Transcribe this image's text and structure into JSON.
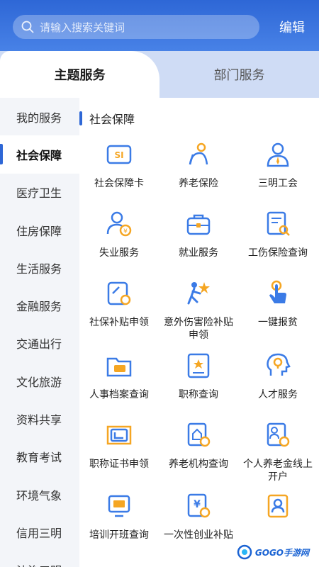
{
  "header": {
    "search_placeholder": "请输入搜索关键词",
    "edit_label": "编辑"
  },
  "tabs": [
    {
      "label": "主题服务",
      "active": true
    },
    {
      "label": "部门服务",
      "active": false
    }
  ],
  "sidebar": {
    "items": [
      {
        "label": "我的服务"
      },
      {
        "label": "社会保障",
        "active": true
      },
      {
        "label": "医疗卫生"
      },
      {
        "label": "住房保障"
      },
      {
        "label": "生活服务"
      },
      {
        "label": "金融服务"
      },
      {
        "label": "交通出行"
      },
      {
        "label": "文化旅游"
      },
      {
        "label": "资料共享"
      },
      {
        "label": "教育考试"
      },
      {
        "label": "环境气象"
      },
      {
        "label": "信用三明"
      },
      {
        "label": "法治三明"
      }
    ]
  },
  "section": {
    "title": "社会保障",
    "services": [
      {
        "label": "社会保障卡",
        "icon": "social-security-card-icon"
      },
      {
        "label": "养老保险",
        "icon": "pension-insurance-icon"
      },
      {
        "label": "三明工会",
        "icon": "trade-union-icon"
      },
      {
        "label": "失业服务",
        "icon": "unemployment-icon"
      },
      {
        "label": "就业服务",
        "icon": "briefcase-icon"
      },
      {
        "label": "工伤保险查询",
        "icon": "injury-insurance-query-icon"
      },
      {
        "label": "社保补贴申领",
        "icon": "subsidy-apply-icon"
      },
      {
        "label": "意外伤害险补贴申领",
        "icon": "accident-insurance-icon"
      },
      {
        "label": "一键报贫",
        "icon": "tap-hand-icon"
      },
      {
        "label": "人事档案查询",
        "icon": "archive-folder-icon"
      },
      {
        "label": "职称查询",
        "icon": "title-certificate-icon"
      },
      {
        "label": "人才服务",
        "icon": "talent-head-icon"
      },
      {
        "label": "职称证书申领",
        "icon": "certificate-book-icon"
      },
      {
        "label": "养老机构查询",
        "icon": "elderly-institution-icon"
      },
      {
        "label": "个人养老金线上开户",
        "icon": "personal-pension-icon"
      },
      {
        "label": "培训开班查询",
        "icon": "training-screen-icon"
      },
      {
        "label": "一次性创业补贴",
        "icon": "startup-subsidy-icon"
      },
      {
        "label": "",
        "icon": "id-badge-icon"
      }
    ]
  },
  "watermark": {
    "text": "GOGO手游网"
  },
  "colors": {
    "primary": "#2e67d6",
    "icon_blue": "#3b7be6",
    "icon_orange": "#f5a623"
  }
}
